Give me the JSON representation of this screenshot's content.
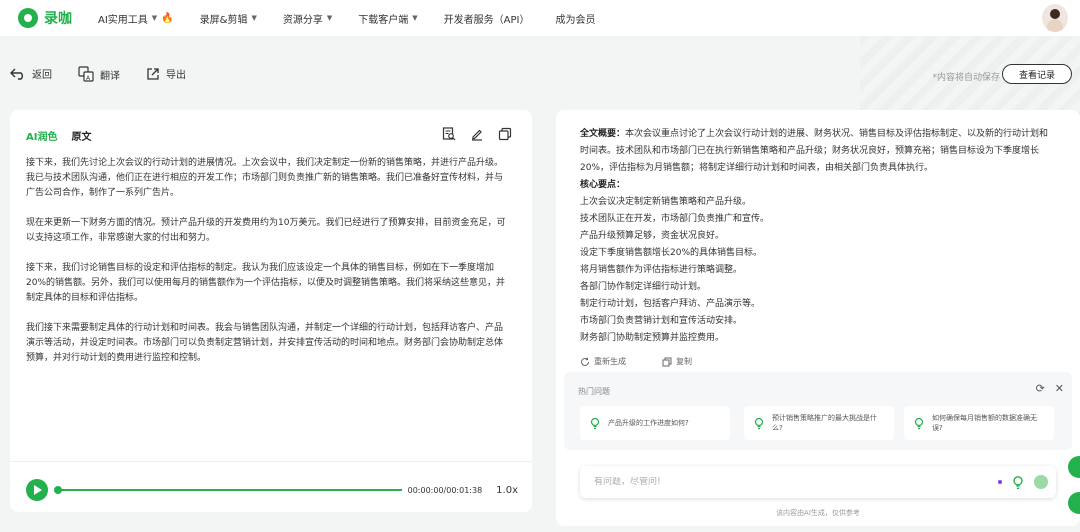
{
  "app": {
    "logo_text": "录咖",
    "accent": "#22b14c"
  },
  "nav": [
    {
      "label": "AI实用工具",
      "caret": true,
      "fire": true
    },
    {
      "label": "录屏&剪辑",
      "caret": true
    },
    {
      "label": "资源分享",
      "caret": true
    },
    {
      "label": "下载客户端",
      "caret": true
    },
    {
      "label": "开发者服务（API）"
    },
    {
      "label": "成为会员"
    }
  ],
  "actions": {
    "back": "返回",
    "translate": "翻译",
    "export": "导出",
    "autosave": "*内容将自动保存",
    "history": "查看记录"
  },
  "left": {
    "tab_ai": "AI润色",
    "tab_original": "原文",
    "paragraphs": [
      "接下来，我们先讨论上次会议的行动计划的进展情况。上次会议中，我们决定制定一份新的销售策略，并进行产品升级。我已与技术团队沟通，他们正在进行相应的开发工作；市场部门则负责推广新的销售策略。我们已准备好宣传材料，并与广告公司合作，制作了一系列广告片。",
      "现在来更新一下财务方面的情况。预计产品升级的开发费用约为10万美元。我们已经进行了预算安排，目前资金充足，可以支持这项工作，非常感谢大家的付出和努力。",
      "接下来，我们讨论销售目标的设定和评估指标的制定。我认为我们应该设定一个具体的销售目标，例如在下一季度增加20%的销售额。另外，我们可以使用每月的销售额作为一个评估指标，以便及时调整销售策略。我们将采纳这些意见，并制定具体的目标和评估指标。",
      "我们接下来需要制定具体的行动计划和时间表。我会与销售团队沟通，并制定一个详细的行动计划，包括拜访客户、产品演示等活动，并设定时间表。市场部门可以负责制定营销计划，并安排宣传活动的时间和地点。财务部门会协助制定总体预算，并对行动计划的费用进行监控和控制。"
    ],
    "player": {
      "time": "00:00:00/00:01:38",
      "speed": "1.0x",
      "progress": 1.0
    }
  },
  "right": {
    "summary_label": "全文概要：",
    "summary_text": "本次会议重点讨论了上次会议行动计划的进展、财务状况、销售目标及评估指标制定、以及新的行动计划和时间表。技术团队和市场部门已在执行新销售策略和产品升级；财务状况良好，预算充裕；销售目标设为下季度增长20%，评估指标为月销售额；将制定详细行动计划和时间表，由相关部门负责具体执行。",
    "keypoints_label": "核心要点：",
    "keypoints": [
      "上次会议决定制定新销售策略和产品升级。",
      "技术团队正在开发，市场部门负责推广和宣传。",
      "产品升级预算足够，资金状况良好。",
      "设定下季度销售额增长20%的具体销售目标。",
      "将月销售额作为评估指标进行策略调整。",
      "各部门协作制定详细行动计划。",
      "制定行动计划，包括客户拜访、产品演示等。",
      "市场部门负责营销计划和宣传活动安排。",
      "财务部门协助制定预算并监控费用。"
    ],
    "regenerate": "重新生成",
    "copy": "复制",
    "hot_title": "热门问题",
    "questions": [
      "产品升级的工作进度如何?",
      "预计销售策略推广的最大挑战是什么?",
      "如何确保每月销售额的数据准确无误?"
    ],
    "ask_placeholder": "有问题，尽管问!",
    "disclaimer": "该内容由AI生成，仅供参考"
  }
}
